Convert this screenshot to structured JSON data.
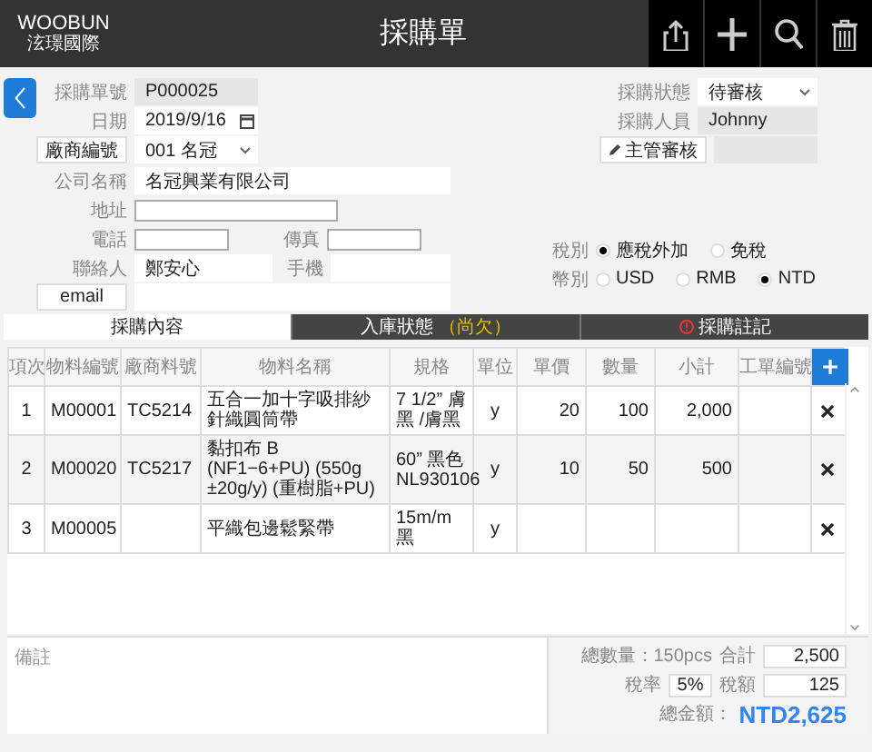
{
  "header": {
    "logo_line1": "WOOBUN",
    "logo_line2": "泫璟國際",
    "title": "採購單"
  },
  "form": {
    "order_no": {
      "label": "採購單號",
      "value": "P000025"
    },
    "date": {
      "label": "日期",
      "value": "2019/9/16"
    },
    "vendor": {
      "label": "廠商編號",
      "value": "001 名冠"
    },
    "company": {
      "label": "公司名稱",
      "value": "名冠興業有限公司"
    },
    "address": {
      "label": "地址"
    },
    "phone": {
      "label": "電話"
    },
    "fax": {
      "label": "傳真"
    },
    "contact": {
      "label": "聯絡人",
      "value": "鄭安心"
    },
    "mobile": {
      "label": "手機"
    },
    "email": {
      "label": "email"
    },
    "status": {
      "label": "採購狀態",
      "value": "待審核"
    },
    "buyer": {
      "label": "採購人員",
      "value": "Johnny"
    },
    "approve": {
      "label": "主管審核"
    },
    "tax": {
      "label": "稅別",
      "options": [
        {
          "label": "應稅外加",
          "selected": true
        },
        {
          "label": "免稅",
          "selected": false
        }
      ]
    },
    "currency": {
      "label": "幣別",
      "options": [
        {
          "label": "USD",
          "selected": false
        },
        {
          "label": "RMB",
          "selected": false
        },
        {
          "label": "NTD",
          "selected": true
        }
      ]
    }
  },
  "tabs": [
    {
      "label": "採購內容",
      "selected": true
    },
    {
      "label": "入庫狀態",
      "status": "（尚欠）",
      "selected": false
    },
    {
      "label": "採購註記",
      "warning": true,
      "selected": false
    }
  ],
  "table": {
    "columns": [
      "項次",
      "物料編號",
      "廠商料號",
      "物料名稱",
      "規格",
      "單位",
      "單價",
      "數量",
      "小計",
      "工單編號"
    ],
    "rows": [
      [
        "1",
        "M00001",
        "TC5214",
        "五合一加十字吸排紗針織圓筒帶",
        "7 1/2” 膚黑 /膚黑",
        "y",
        "20",
        "100",
        "2,000",
        null
      ],
      [
        "2",
        "M00020",
        "TC5217",
        "黏扣布 B (NF1−6+PU) (550g ±20g/y) (重樹脂+PU)",
        "60” 黑色 NL930106",
        "y",
        "10",
        "50",
        "500",
        null
      ],
      [
        "3",
        "M00005",
        null,
        "平織包邊鬆緊帶",
        "15m/m 黑",
        "y",
        null,
        null,
        null,
        null
      ]
    ]
  },
  "remarks": {
    "placeholder": "備註"
  },
  "summary": {
    "total_qty": "總數量：150pcs",
    "sum_label": "合計",
    "sum": "2,500",
    "tax_rate_label": "稅率",
    "tax_rate": "5%",
    "tax_label": "稅額",
    "tax": "125",
    "grand_label": "總金額：",
    "grand": "NTD2,625"
  }
}
